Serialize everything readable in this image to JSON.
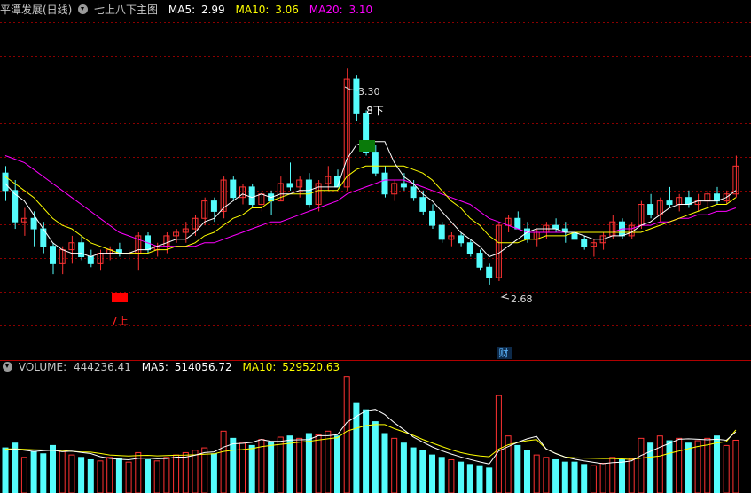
{
  "header": {
    "title": "平潭发展(日线)",
    "indicator_name": "七上八下主图",
    "ma5_label": "MA5:",
    "ma5_value": "2.99",
    "ma10_label": "MA10:",
    "ma10_value": "3.06",
    "ma20_label": "MA20:",
    "ma20_value": "3.10"
  },
  "volume_header": {
    "label": "VOLUME:",
    "value": "444236.41",
    "ma5_label": "MA5:",
    "ma5_value": "514056.72",
    "ma10_label": "MA10:",
    "ma10_value": "529520.63"
  },
  "annotations": {
    "high_label": "3.30",
    "low_label": "2.68",
    "up_signal_label": "7上",
    "down_signal_label": "8下",
    "finance_marker": "财"
  },
  "colors": {
    "background": "#000000",
    "up_candle": "#ff3232",
    "down_candle": "#54fcfc",
    "ma5": "#ffffff",
    "ma10": "#ffff00",
    "ma20": "#ff00ff",
    "grid": "#8a0000",
    "title": "#c8c8c8",
    "up_signal": "#ff0000",
    "down_signal": "#008000"
  },
  "chart_data": [
    {
      "type": "candlestick",
      "title": "平潭发展(日线)",
      "ylim": [
        2.55,
        3.4
      ],
      "grid": true,
      "extremes": {
        "high": 3.3,
        "low": 2.68
      },
      "ohlc": [
        [
          3.0,
          3.02,
          2.92,
          2.95
        ],
        [
          2.95,
          2.98,
          2.84,
          2.86
        ],
        [
          2.86,
          2.9,
          2.82,
          2.87
        ],
        [
          2.87,
          2.89,
          2.79,
          2.84
        ],
        [
          2.84,
          2.86,
          2.77,
          2.79
        ],
        [
          2.79,
          2.8,
          2.71,
          2.74
        ],
        [
          2.74,
          2.79,
          2.71,
          2.78
        ],
        [
          2.78,
          2.82,
          2.74,
          2.8
        ],
        [
          2.8,
          2.82,
          2.75,
          2.76
        ],
        [
          2.76,
          2.78,
          2.73,
          2.74
        ],
        [
          2.74,
          2.78,
          2.72,
          2.77
        ],
        [
          2.77,
          2.79,
          2.75,
          2.78
        ],
        [
          2.78,
          2.8,
          2.76,
          2.77
        ],
        [
          2.77,
          2.78,
          2.75,
          2.77
        ],
        [
          2.77,
          2.83,
          2.72,
          2.82
        ],
        [
          2.82,
          2.83,
          2.77,
          2.78
        ],
        [
          2.78,
          2.8,
          2.76,
          2.79
        ],
        [
          2.79,
          2.83,
          2.77,
          2.82
        ],
        [
          2.82,
          2.84,
          2.8,
          2.83
        ],
        [
          2.83,
          2.86,
          2.8,
          2.84
        ],
        [
          2.84,
          2.88,
          2.82,
          2.87
        ],
        [
          2.87,
          2.93,
          2.85,
          2.92
        ],
        [
          2.92,
          2.93,
          2.86,
          2.89
        ],
        [
          2.89,
          2.99,
          2.87,
          2.98
        ],
        [
          2.98,
          2.99,
          2.92,
          2.93
        ],
        [
          2.93,
          2.97,
          2.91,
          2.96
        ],
        [
          2.96,
          2.97,
          2.9,
          2.91
        ],
        [
          2.91,
          2.95,
          2.89,
          2.94
        ],
        [
          2.94,
          2.95,
          2.88,
          2.92
        ],
        [
          2.92,
          2.99,
          2.92,
          2.97
        ],
        [
          2.97,
          3.03,
          2.95,
          2.96
        ],
        [
          2.96,
          2.99,
          2.93,
          2.98
        ],
        [
          2.98,
          3.0,
          2.9,
          2.91
        ],
        [
          2.91,
          2.98,
          2.89,
          2.97
        ],
        [
          2.97,
          3.02,
          2.95,
          2.99
        ],
        [
          2.99,
          3.01,
          2.96,
          2.96
        ],
        [
          2.96,
          3.3,
          2.95,
          3.27
        ],
        [
          3.27,
          3.28,
          3.15,
          3.17
        ],
        [
          3.17,
          3.18,
          3.05,
          3.06
        ],
        [
          3.06,
          3.08,
          2.99,
          3.0
        ],
        [
          3.0,
          3.02,
          2.93,
          2.94
        ],
        [
          2.94,
          2.98,
          2.92,
          2.97
        ],
        [
          2.97,
          3.0,
          2.95,
          2.96
        ],
        [
          2.96,
          2.98,
          2.92,
          2.93
        ],
        [
          2.93,
          2.95,
          2.88,
          2.89
        ],
        [
          2.89,
          2.91,
          2.84,
          2.85
        ],
        [
          2.85,
          2.86,
          2.8,
          2.81
        ],
        [
          2.81,
          2.83,
          2.79,
          2.82
        ],
        [
          2.82,
          2.83,
          2.79,
          2.8
        ],
        [
          2.8,
          2.81,
          2.76,
          2.77
        ],
        [
          2.77,
          2.78,
          2.72,
          2.73
        ],
        [
          2.73,
          2.74,
          2.68,
          2.7
        ],
        [
          2.7,
          2.86,
          2.69,
          2.85
        ],
        [
          2.85,
          2.88,
          2.83,
          2.87
        ],
        [
          2.87,
          2.89,
          2.84,
          2.84
        ],
        [
          2.84,
          2.86,
          2.8,
          2.81
        ],
        [
          2.81,
          2.84,
          2.79,
          2.83
        ],
        [
          2.83,
          2.86,
          2.81,
          2.85
        ],
        [
          2.85,
          2.87,
          2.83,
          2.84
        ],
        [
          2.84,
          2.86,
          2.8,
          2.83
        ],
        [
          2.83,
          2.84,
          2.8,
          2.81
        ],
        [
          2.81,
          2.82,
          2.78,
          2.79
        ],
        [
          2.79,
          2.81,
          2.76,
          2.8
        ],
        [
          2.8,
          2.83,
          2.78,
          2.82
        ],
        [
          2.82,
          2.88,
          2.81,
          2.86
        ],
        [
          2.86,
          2.87,
          2.81,
          2.82
        ],
        [
          2.82,
          2.86,
          2.81,
          2.85
        ],
        [
          2.85,
          2.92,
          2.84,
          2.91
        ],
        [
          2.91,
          2.94,
          2.87,
          2.88
        ],
        [
          2.88,
          2.93,
          2.86,
          2.92
        ],
        [
          2.92,
          2.96,
          2.9,
          2.91
        ],
        [
          2.91,
          2.94,
          2.89,
          2.93
        ],
        [
          2.93,
          2.95,
          2.9,
          2.91
        ],
        [
          2.91,
          2.94,
          2.89,
          2.92
        ],
        [
          2.92,
          2.95,
          2.9,
          2.94
        ],
        [
          2.94,
          2.96,
          2.91,
          2.92
        ],
        [
          2.92,
          2.95,
          2.91,
          2.94
        ],
        [
          2.94,
          3.05,
          2.93,
          3.02
        ]
      ],
      "ma5": [
        2.97,
        2.94,
        2.92,
        2.88,
        2.84,
        2.8,
        2.78,
        2.77,
        2.77,
        2.76,
        2.77,
        2.77,
        2.77,
        2.77,
        2.78,
        2.78,
        2.79,
        2.8,
        2.81,
        2.81,
        2.83,
        2.86,
        2.87,
        2.9,
        2.92,
        2.94,
        2.93,
        2.94,
        2.93,
        2.94,
        2.94,
        2.95,
        2.95,
        2.96,
        2.96,
        2.96,
        3.04,
        3.08,
        3.09,
        3.09,
        3.09,
        3.03,
        2.99,
        2.97,
        2.94,
        2.92,
        2.89,
        2.86,
        2.83,
        2.81,
        2.79,
        2.76,
        2.77,
        2.79,
        2.81,
        2.83,
        2.84,
        2.84,
        2.84,
        2.83,
        2.83,
        2.82,
        2.81,
        2.81,
        2.82,
        2.82,
        2.83,
        2.85,
        2.86,
        2.88,
        2.9,
        2.91,
        2.91,
        2.92,
        2.92,
        2.92,
        2.93,
        2.95
      ],
      "ma10": [
        2.99,
        2.97,
        2.95,
        2.93,
        2.9,
        2.87,
        2.85,
        2.84,
        2.82,
        2.8,
        2.79,
        2.78,
        2.77,
        2.77,
        2.77,
        2.77,
        2.78,
        2.78,
        2.79,
        2.79,
        2.8,
        2.82,
        2.83,
        2.85,
        2.87,
        2.88,
        2.9,
        2.9,
        2.92,
        2.93,
        2.94,
        2.94,
        2.94,
        2.95,
        2.95,
        2.95,
        2.99,
        3.01,
        3.02,
        3.02,
        3.02,
        3.02,
        3.02,
        3.01,
        3.0,
        2.98,
        2.95,
        2.92,
        2.9,
        2.87,
        2.85,
        2.82,
        2.8,
        2.8,
        2.8,
        2.81,
        2.81,
        2.82,
        2.82,
        2.82,
        2.83,
        2.83,
        2.83,
        2.83,
        2.83,
        2.83,
        2.83,
        2.83,
        2.84,
        2.85,
        2.86,
        2.87,
        2.88,
        2.89,
        2.9,
        2.91,
        2.91,
        2.93
      ],
      "ma20": [
        3.05,
        3.04,
        3.03,
        3.01,
        2.99,
        2.97,
        2.95,
        2.93,
        2.91,
        2.89,
        2.87,
        2.85,
        2.83,
        2.82,
        2.81,
        2.8,
        2.79,
        2.79,
        2.79,
        2.79,
        2.79,
        2.8,
        2.8,
        2.81,
        2.82,
        2.83,
        2.84,
        2.85,
        2.86,
        2.86,
        2.87,
        2.88,
        2.89,
        2.9,
        2.91,
        2.92,
        2.94,
        2.95,
        2.96,
        2.97,
        2.98,
        2.98,
        2.98,
        2.97,
        2.96,
        2.95,
        2.94,
        2.93,
        2.92,
        2.91,
        2.89,
        2.87,
        2.86,
        2.85,
        2.84,
        2.83,
        2.83,
        2.83,
        2.83,
        2.83,
        2.83,
        2.83,
        2.83,
        2.83,
        2.83,
        2.84,
        2.84,
        2.85,
        2.85,
        2.86,
        2.86,
        2.87,
        2.87,
        2.88,
        2.88,
        2.89,
        2.89,
        2.9
      ]
    },
    {
      "type": "bar",
      "title": "VOLUME",
      "ylim": [
        0,
        1000000
      ],
      "values": [
        380000,
        420000,
        300000,
        350000,
        330000,
        400000,
        360000,
        320000,
        300000,
        280000,
        270000,
        300000,
        290000,
        260000,
        340000,
        280000,
        270000,
        300000,
        320000,
        340000,
        360000,
        380000,
        330000,
        520000,
        460000,
        420000,
        400000,
        450000,
        430000,
        470000,
        480000,
        460000,
        500000,
        490000,
        520000,
        480000,
        980000,
        760000,
        700000,
        600000,
        500000,
        460000,
        420000,
        380000,
        360000,
        320000,
        300000,
        280000,
        260000,
        240000,
        230000,
        210000,
        820000,
        480000,
        400000,
        360000,
        320000,
        300000,
        280000,
        260000,
        260000,
        240000,
        230000,
        250000,
        300000,
        280000,
        290000,
        460000,
        420000,
        480000,
        440000,
        460000,
        420000,
        440000,
        460000,
        480000,
        400000,
        444236.41
      ],
      "ma5": [
        360000,
        370000,
        360000,
        350000,
        356000,
        360000,
        348000,
        352000,
        342000,
        332000,
        306000,
        292000,
        284000,
        280000,
        292000,
        294000,
        288000,
        290000,
        302000,
        302000,
        318000,
        340000,
        346000,
        386000,
        414000,
        418000,
        426000,
        450000,
        434000,
        434000,
        446000,
        448000,
        450000,
        482000,
        482000,
        490000,
        594000,
        644000,
        692000,
        704000,
        660000,
        592000,
        532000,
        472000,
        428000,
        388000,
        356000,
        328000,
        304000,
        282000,
        262000,
        244000,
        354000,
        390000,
        426000,
        456000,
        476000,
        372000,
        332000,
        304000,
        284000,
        270000,
        258000,
        246000,
        256000,
        260000,
        270000,
        316000,
        350000,
        386000,
        418000,
        452000,
        456000,
        452000,
        448000,
        452000,
        444000,
        514056.72
      ],
      "ma10": [
        370000,
        372000,
        368000,
        364000,
        362000,
        360000,
        358000,
        351000,
        346000,
        344000,
        333000,
        320000,
        316000,
        312000,
        316000,
        317000,
        313000,
        315000,
        318000,
        319000,
        322000,
        327000,
        330000,
        350000,
        360000,
        366000,
        374000,
        390000,
        400000,
        410000,
        418000,
        427000,
        434000,
        446000,
        456000,
        466000,
        520000,
        545000,
        567000,
        575000,
        575000,
        541000,
        514000,
        485000,
        451000,
        421000,
        392000,
        364000,
        340000,
        324000,
        313000,
        305000,
        369000,
        406000,
        425000,
        440000,
        449000,
        371000,
        333000,
        303000,
        296000,
        294000,
        292000,
        290000,
        290000,
        287000,
        283000,
        294000,
        302000,
        312000,
        335000,
        353000,
        373000,
        392000,
        405000,
        422000,
        433000,
        529520.63
      ]
    }
  ]
}
